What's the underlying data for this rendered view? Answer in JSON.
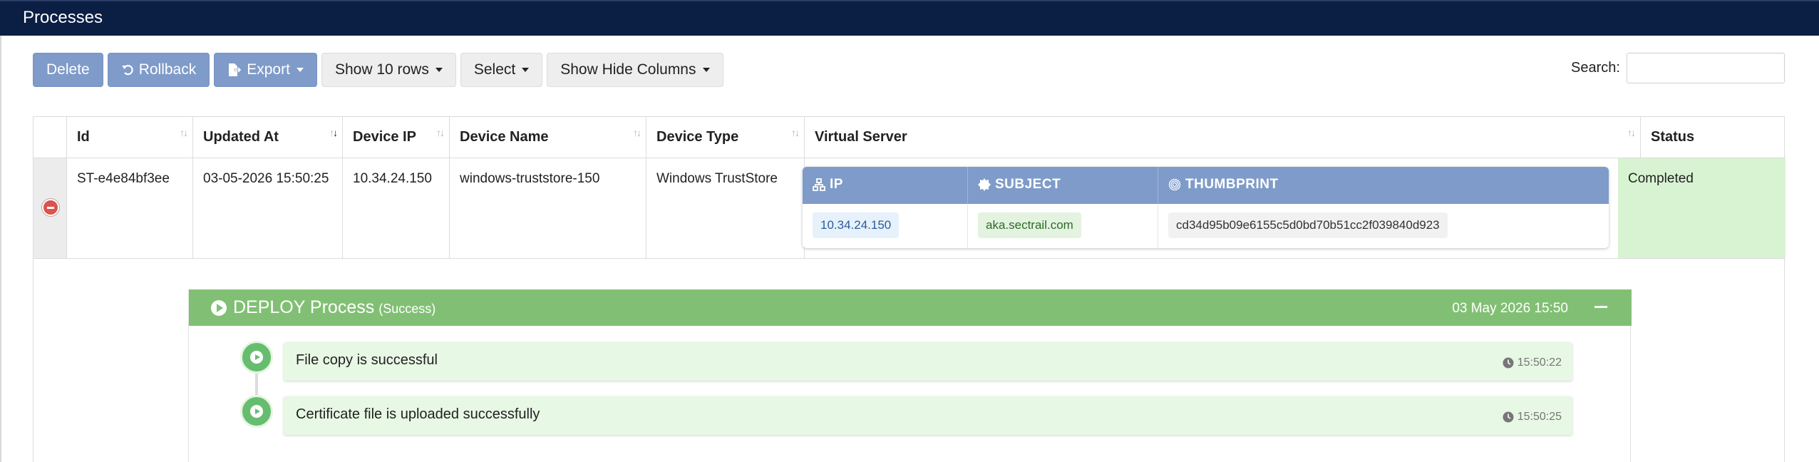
{
  "app": {
    "title": "Processes"
  },
  "toolbar": {
    "delete_label": "Delete",
    "rollback_label": "Rollback",
    "export_label": "Export",
    "rows_label": "Show 10 rows",
    "select_label": "Select",
    "columns_label": "Show Hide Columns"
  },
  "search": {
    "label": "Search:",
    "value": ""
  },
  "table": {
    "columns": [
      "Id",
      "Updated At",
      "Device IP",
      "Device Name",
      "Device Type",
      "Virtual Server",
      "Status"
    ],
    "row": {
      "id": "ST-e4e84bf3ee",
      "updated_at": "03-05-2026 15:50:25",
      "device_ip": "10.34.24.150",
      "device_name": "windows-truststore-150",
      "device_type": "Windows TrustStore",
      "status": "Completed",
      "virtual_server": {
        "headers": [
          "IP",
          "SUBJECT",
          "THUMBPRINT"
        ],
        "ip": "10.34.24.150",
        "subject": "aka.sectrail.com",
        "thumbprint": "cd34d95b09e6155c5d0bd70b51cc2f039840d923"
      }
    }
  },
  "process": {
    "title": "DEPLOY Process",
    "state": "(Success)",
    "date": "03 May 2026 15:50",
    "steps": [
      {
        "text": "File copy is successful",
        "time": "15:50:22"
      },
      {
        "text": "Certificate file is uploaded successfully",
        "time": "15:50:25"
      }
    ]
  },
  "colors": {
    "topbar": "#0b1f44",
    "primary_button": "#7f9bc9",
    "success_header": "#81c074",
    "status_cell": "#d8f3d2",
    "timeline_dot": "#67bd6f"
  }
}
